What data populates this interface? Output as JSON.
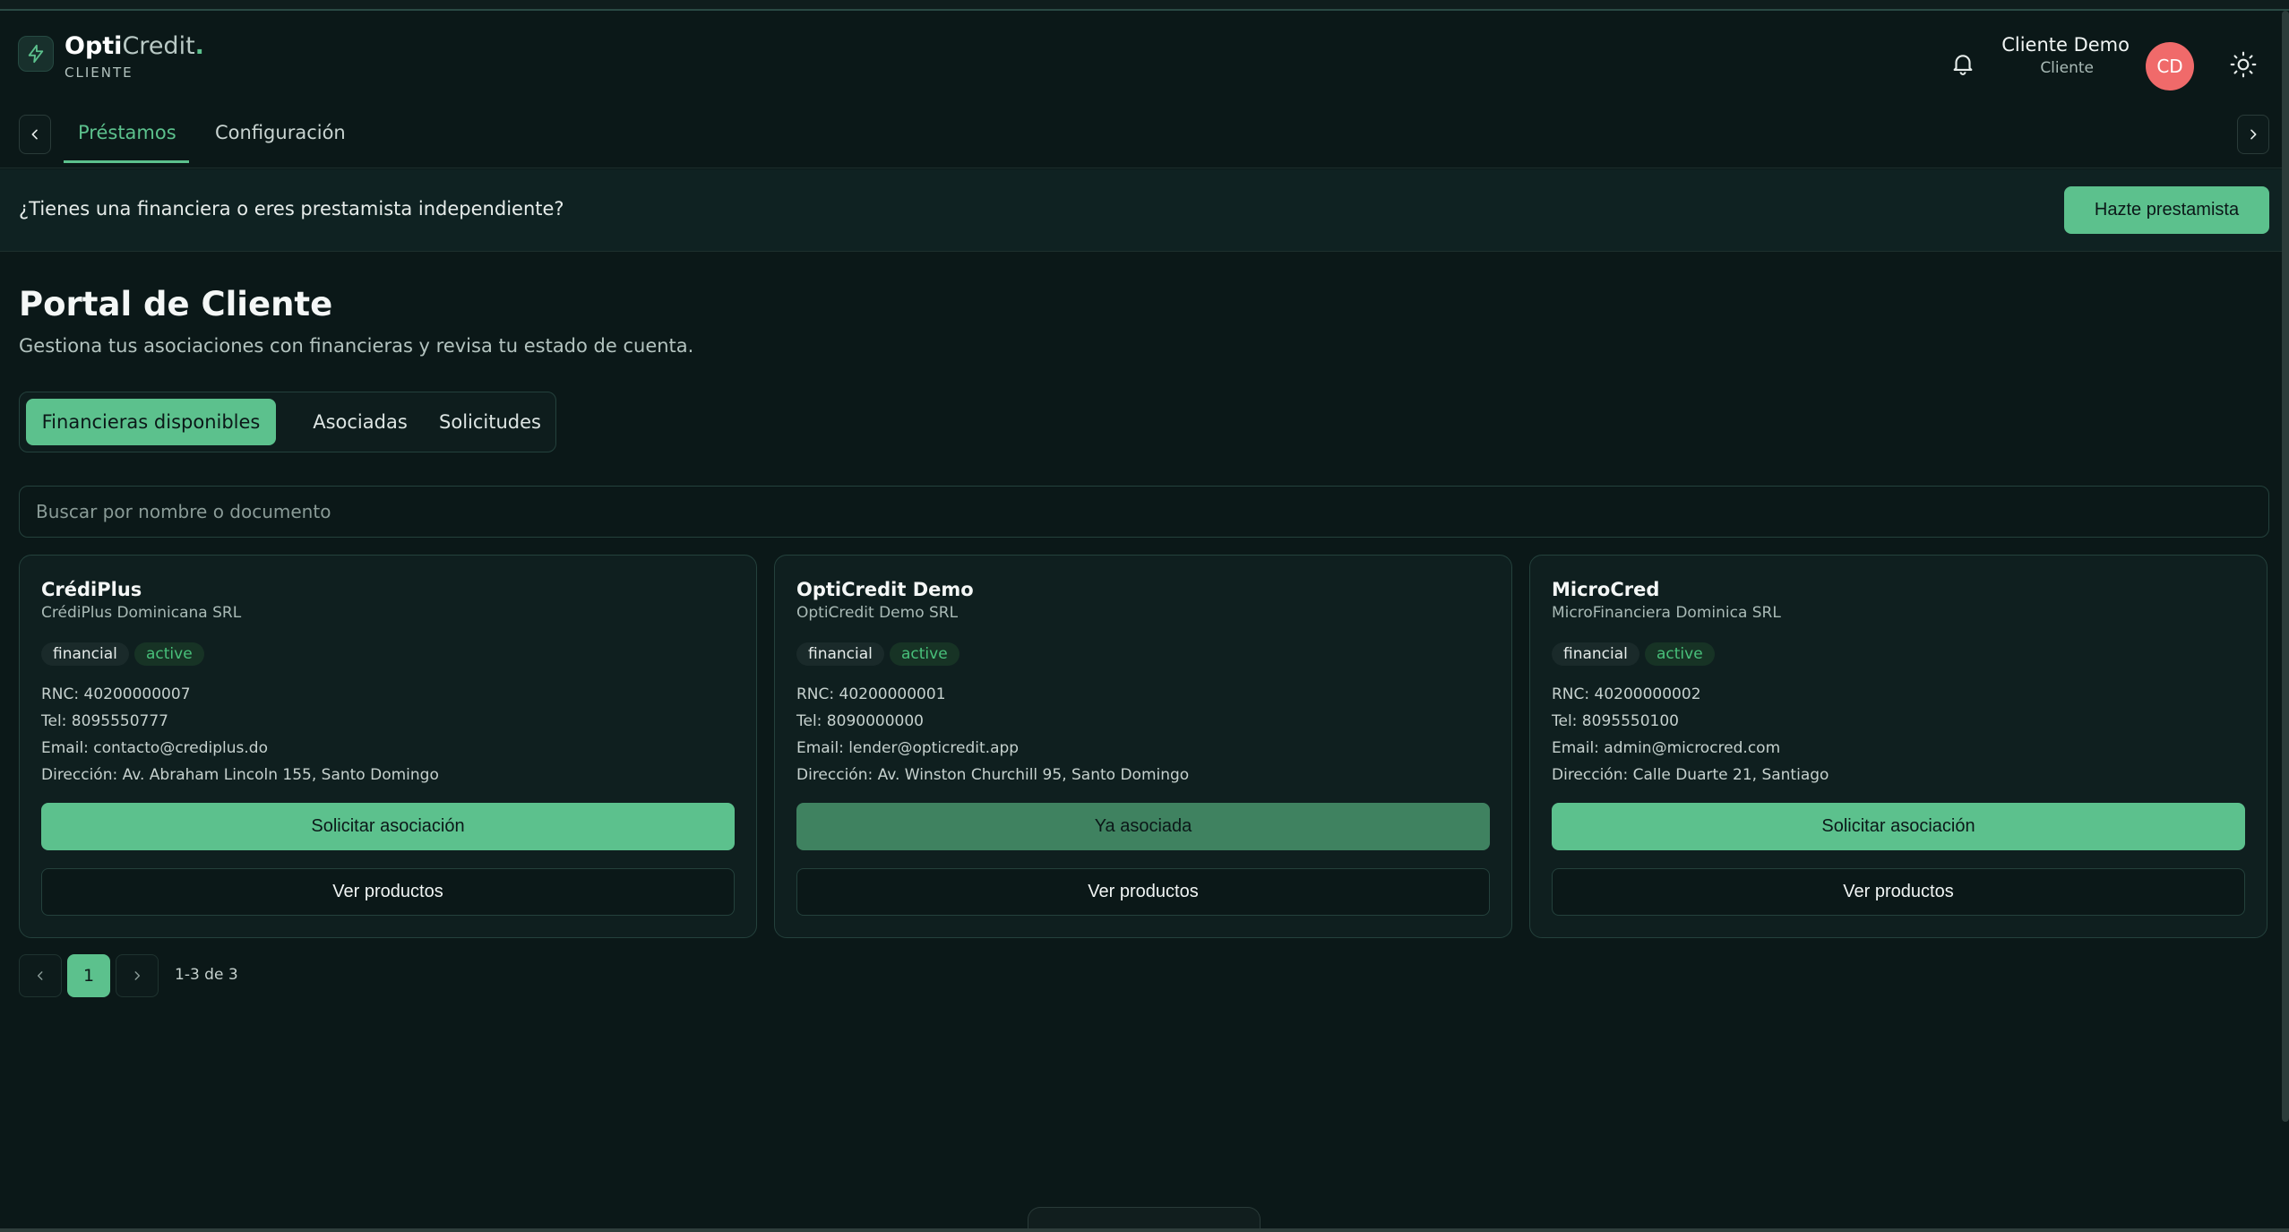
{
  "app": {
    "logo_bold": "Opti",
    "logo_light": "Credit",
    "logo_dot": ".",
    "logo_sub": "CLIENTE"
  },
  "user": {
    "name": "Cliente Demo",
    "role": "Cliente",
    "initials": "CD"
  },
  "nav": {
    "tabs": [
      {
        "label": "Préstamos",
        "active": true
      },
      {
        "label": "Configuración",
        "active": false
      }
    ]
  },
  "banner": {
    "text": "¿Tienes una financiera o eres prestamista independiente?",
    "button": "Hazte prestamista"
  },
  "page": {
    "title": "Portal de Cliente",
    "subtitle": "Gestiona tus asociaciones con financieras y revisa tu estado de cuenta."
  },
  "segments": [
    {
      "label": "Financieras disponibles",
      "active": true
    },
    {
      "label": "Asociadas",
      "active": false
    },
    {
      "label": "Solicitudes",
      "active": false
    }
  ],
  "search": {
    "placeholder": "Buscar por nombre o documento",
    "value": ""
  },
  "cards": [
    {
      "name": "CrédiPlus",
      "legal": "CrédiPlus Dominicana SRL",
      "type": "financial",
      "status": "active",
      "rnc": "RNC: 40200000007",
      "tel": "Tel: 8095550777",
      "email": "Email: contacto@crediplus.do",
      "address": "Dirección: Av. Abraham Lincoln 155, Santo Domingo",
      "primary": "Solicitar asociación",
      "secondary": "Ver productos"
    },
    {
      "name": "OptiCredit Demo",
      "legal": "OptiCredit Demo SRL",
      "type": "financial",
      "status": "active",
      "rnc": "RNC: 40200000001",
      "tel": "Tel: 8090000000",
      "email": "Email: lender@opticredit.app",
      "address": "Dirección: Av. Winston Churchill 95, Santo Domingo",
      "primary": "Ya asociada",
      "secondary": "Ver productos"
    },
    {
      "name": "MicroCred",
      "legal": "MicroFinanciera Dominica SRL",
      "type": "financial",
      "status": "active",
      "rnc": "RNC: 40200000002",
      "tel": "Tel: 8095550100",
      "email": "Email: admin@microcred.com",
      "address": "Dirección: Calle Duarte 21, Santiago",
      "primary": "Solicitar asociación",
      "secondary": "Ver productos"
    }
  ],
  "pagination": {
    "current": "1",
    "info": "1-3 de 3"
  },
  "colors": {
    "accent": "#5cc18d",
    "background": "#0b1818",
    "avatar": "#f06a6a"
  },
  "icons": [
    "bolt-icon",
    "bell-icon",
    "sun-icon",
    "chevron-left-icon",
    "chevron-right-icon"
  ]
}
